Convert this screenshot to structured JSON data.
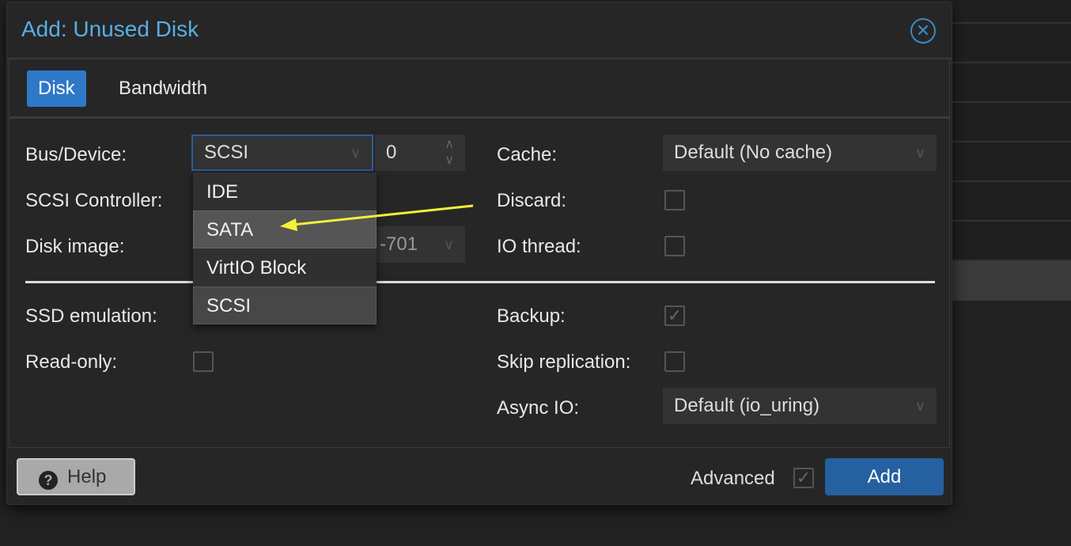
{
  "dialog": {
    "title": "Add: Unused Disk",
    "tabs": [
      {
        "label": "Disk",
        "active": true
      },
      {
        "label": "Bandwidth",
        "active": false
      }
    ],
    "left": {
      "bus_device_label": "Bus/Device:",
      "bus_value": "SCSI",
      "device_number": "0",
      "scsi_controller_label": "SCSI Controller:",
      "disk_image_label": "Disk image:",
      "disk_image_value_partial": "-701",
      "ssd_emulation_label": "SSD emulation:",
      "read_only_label": "Read-only:",
      "read_only_checked": false
    },
    "right": {
      "cache_label": "Cache:",
      "cache_value": "Default (No cache)",
      "discard_label": "Discard:",
      "discard_checked": false,
      "io_thread_label": "IO thread:",
      "io_thread_checked": false,
      "backup_label": "Backup:",
      "backup_checked": true,
      "skip_replication_label": "Skip replication:",
      "skip_replication_checked": false,
      "async_io_label": "Async IO:",
      "async_io_value": "Default (io_uring)"
    },
    "bus_options": [
      "IDE",
      "SATA",
      "VirtIO Block",
      "SCSI"
    ],
    "hovered_option": "SATA",
    "selected_option": "SCSI",
    "footer": {
      "help_label": "Help",
      "advanced_label": "Advanced",
      "advanced_checked": true,
      "add_label": "Add"
    }
  },
  "colors": {
    "accent": "#2f78c8",
    "title": "#5aaee6",
    "add_button": "#2560a0",
    "annotation_arrow": "#f5f03a"
  },
  "icons": {
    "close": "close-circle-icon",
    "help": "question-circle-icon",
    "chevron": "chevron-down-icon",
    "spinner": "up-down-spinner-icon"
  }
}
